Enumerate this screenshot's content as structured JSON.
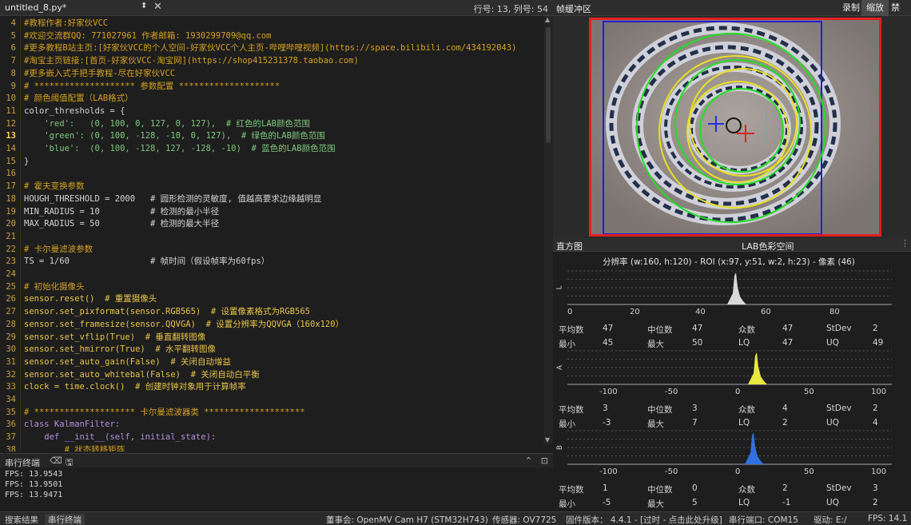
{
  "editor": {
    "filename": "untitled_8.py*",
    "position": "行号: 13, 列号: 54",
    "lines": [
      {
        "n": "4",
        "t": "#教程作者:好家伙VCC"
      },
      {
        "n": "5",
        "t": "#欢迎交流群QQ: 771027961 作者邮箱: 1930299709@qq.com"
      },
      {
        "n": "6",
        "t": "#更多教程B站主页:[好家伙VCC的个人空间-好家伙VCC个人主页-哔哩哔哩视频](https://space.bilibili.com/434192043)"
      },
      {
        "n": "7",
        "t": "#淘宝主页链接:[首页-好家伙VCC-淘宝网](https://shop415231378.taobao.com)"
      },
      {
        "n": "8",
        "t": "#更多嵌入式手把手教程-尽在好家伙VCC"
      },
      {
        "n": "9",
        "t": "# ******************** 参数配置 ********************"
      },
      {
        "n": "10",
        "t": "# 颜色阈值配置（LAB格式）"
      },
      {
        "n": "11",
        "t": "color_thresholds = {"
      },
      {
        "n": "12",
        "t": "    'red':   (0, 100, 0, 127, 0, 127),  # 红色的LAB颜色范围"
      },
      {
        "n": "13",
        "t": "    'green': (0, 100, -128, -10, 0, 127),  # 绿色的LAB颜色范围"
      },
      {
        "n": "14",
        "t": "    'blue':  (0, 100, -128, 127, -128, -10)  # 蓝色的LAB颜色范围"
      },
      {
        "n": "15",
        "t": "}"
      },
      {
        "n": "16",
        "t": ""
      },
      {
        "n": "17",
        "t": "# 霍夫变换参数"
      },
      {
        "n": "18",
        "t": "HOUGH_THRESHOLD = 2000   # 圆形检测的灵敏度, 值越高要求边缘越明显"
      },
      {
        "n": "19",
        "t": "MIN_RADIUS = 10          # 检测的最小半径"
      },
      {
        "n": "20",
        "t": "MAX_RADIUS = 50          # 检测的最大半径"
      },
      {
        "n": "21",
        "t": ""
      },
      {
        "n": "22",
        "t": "# 卡尔曼滤波参数"
      },
      {
        "n": "23",
        "t": "TS = 1/60                # 帧时间（假设帧率为60fps）"
      },
      {
        "n": "24",
        "t": ""
      },
      {
        "n": "25",
        "t": "# 初始化摄像头"
      },
      {
        "n": "26",
        "t": "sensor.reset()  # 重置摄像头"
      },
      {
        "n": "27",
        "t": "sensor.set_pixformat(sensor.RGB565)  # 设置像素格式为RGB565"
      },
      {
        "n": "28",
        "t": "sensor.set_framesize(sensor.QQVGA)  # 设置分辨率为QQVGA（160x120）"
      },
      {
        "n": "29",
        "t": "sensor.set_vflip(True)  # 垂直翻转图像"
      },
      {
        "n": "30",
        "t": "sensor.set_hmirror(True)  # 水平翻转图像"
      },
      {
        "n": "31",
        "t": "sensor.set_auto_gain(False)  # 关闭自动增益"
      },
      {
        "n": "32",
        "t": "sensor.set_auto_whitebal(False)  # 关闭自动白平衡"
      },
      {
        "n": "33",
        "t": "clock = time.clock()  # 创建时钟对象用于计算帧率"
      },
      {
        "n": "34",
        "t": ""
      },
      {
        "n": "35",
        "t": "# ******************** 卡尔曼滤波器类 ********************"
      },
      {
        "n": "36",
        "t": "class KalmanFilter:"
      },
      {
        "n": "37",
        "t": "    def __init__(self, initial_state):"
      },
      {
        "n": "38",
        "t": "        # 状态转移矩阵"
      }
    ]
  },
  "terminal": {
    "title": "串行终端",
    "lines": [
      "FPS: 13.9543",
      "FPS: 13.9501",
      "FPS: 13.9471"
    ]
  },
  "framebuffer": {
    "title": "帧缓冲区",
    "buttons": [
      "录制",
      "缩放",
      "禁用"
    ]
  },
  "histogram": {
    "title": "直方图",
    "mode": "LAB色彩空间",
    "resolution": "分辨率 (w:160, h:120) - ROI (x:97, y:51, w:2, h:23) - 像素 (46)",
    "channels": [
      {
        "name": "L",
        "ticks": [
          "0",
          "20",
          "40",
          "60",
          "80"
        ],
        "stats": {
          "mean": "47",
          "median": "47",
          "mode": "47",
          "stdev": "2",
          "min": "45",
          "max": "50",
          "lq": "47",
          "uq": "49"
        }
      },
      {
        "name": "A",
        "ticks": [
          "-100",
          "-50",
          "0",
          "50",
          "100"
        ],
        "stats": {
          "mean": "3",
          "median": "3",
          "mode": "4",
          "stdev": "2",
          "min": "-3",
          "max": "7",
          "lq": "2",
          "uq": "4"
        }
      },
      {
        "name": "B",
        "ticks": [
          "-100",
          "-50",
          "0",
          "50",
          "100"
        ],
        "stats": {
          "mean": "1",
          "median": "0",
          "mode": "2",
          "stdev": "3",
          "min": "-5",
          "max": "5",
          "lq": "-1",
          "uq": "2"
        }
      }
    ],
    "labels": {
      "mean": "平均数",
      "median": "中位数",
      "mode": "众数",
      "stdev": "StDev",
      "min": "最小",
      "max": "最大",
      "lq": "LQ",
      "uq": "UQ"
    }
  },
  "status": {
    "tab_search": "搜索结果",
    "tab_terminal": "串行终端",
    "board": "董事会:  OpenMV Cam H7 (STM32H743)",
    "sensor": "传感器: OV7725",
    "firmware": "固件版本： 4.4.1 - [过时 - 点击此处升级]",
    "port": "串行端口: COM15",
    "drive": "驱动: E:/",
    "fps": "FPS:  14.1"
  }
}
